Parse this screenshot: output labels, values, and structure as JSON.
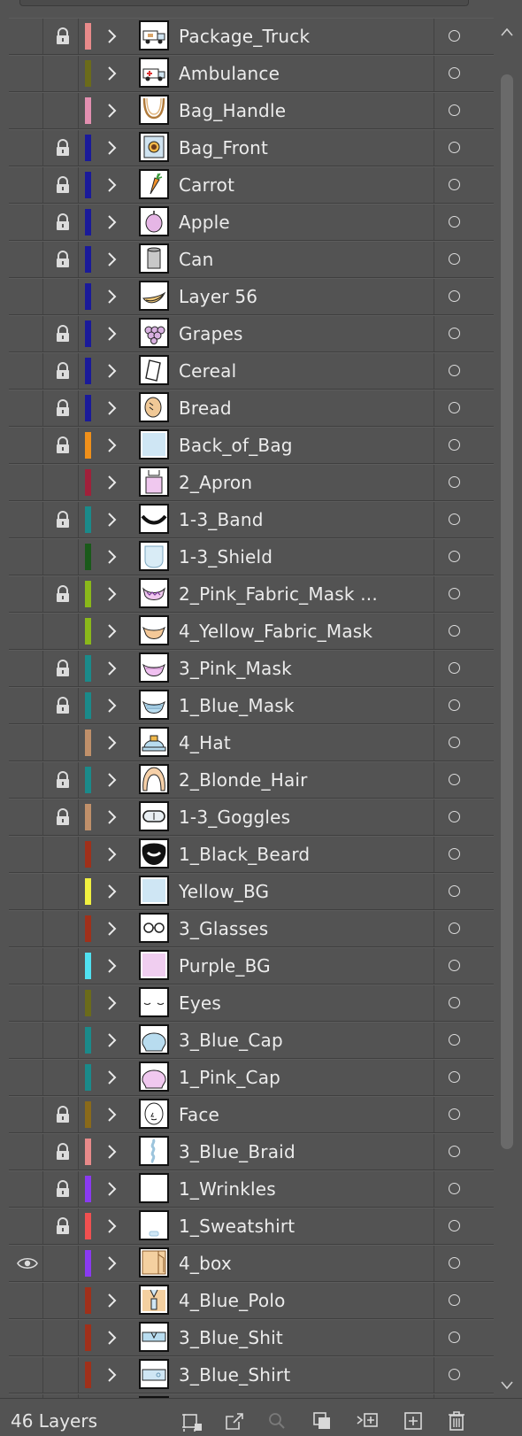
{
  "layers": [
    {
      "name": "Package_Truck",
      "locked": true,
      "visible": false,
      "color": "#e88a8a",
      "thumb": "truck"
    },
    {
      "name": "Ambulance",
      "locked": false,
      "visible": false,
      "color": "#6b6b1a",
      "thumb": "ambulance"
    },
    {
      "name": "Bag_Handle",
      "locked": false,
      "visible": false,
      "color": "#e28fb0",
      "thumb": "handle"
    },
    {
      "name": "Bag_Front",
      "locked": true,
      "visible": false,
      "color": "#1a1a9a",
      "thumb": "bagfront"
    },
    {
      "name": "Carrot",
      "locked": true,
      "visible": false,
      "color": "#1a1a9a",
      "thumb": "carrot"
    },
    {
      "name": "Apple",
      "locked": true,
      "visible": false,
      "color": "#1a1a9a",
      "thumb": "apple"
    },
    {
      "name": "Can",
      "locked": true,
      "visible": false,
      "color": "#1a1a9a",
      "thumb": "can"
    },
    {
      "name": "Layer 56",
      "locked": false,
      "visible": false,
      "color": "#1a1a9a",
      "thumb": "banana"
    },
    {
      "name": "Grapes",
      "locked": true,
      "visible": false,
      "color": "#1a1a9a",
      "thumb": "grapes"
    },
    {
      "name": "Cereal",
      "locked": true,
      "visible": false,
      "color": "#1a1a9a",
      "thumb": "cereal"
    },
    {
      "name": "Bread",
      "locked": true,
      "visible": false,
      "color": "#1a1a9a",
      "thumb": "bread"
    },
    {
      "name": "Back_of_Bag",
      "locked": true,
      "visible": false,
      "color": "#f0901a",
      "thumb": "lightblue"
    },
    {
      "name": "2_Apron",
      "locked": false,
      "visible": false,
      "color": "#a0203a",
      "thumb": "apron"
    },
    {
      "name": "1-3_Band",
      "locked": true,
      "visible": false,
      "color": "#1a8a8a",
      "thumb": "band"
    },
    {
      "name": "1-3_Shield",
      "locked": false,
      "visible": false,
      "color": "#1a5a1a",
      "thumb": "shield"
    },
    {
      "name": "2_Pink_Fabric_Mask ...",
      "locked": true,
      "visible": false,
      "color": "#8ab81a",
      "thumb": "pinkmask2"
    },
    {
      "name": "4_Yellow_Fabric_Mask",
      "locked": false,
      "visible": false,
      "color": "#8ab81a",
      "thumb": "yellowmask"
    },
    {
      "name": "3_Pink_Mask",
      "locked": true,
      "visible": false,
      "color": "#1a8a8a",
      "thumb": "pinkmask"
    },
    {
      "name": "1_Blue_Mask",
      "locked": true,
      "visible": false,
      "color": "#1a8a8a",
      "thumb": "bluemask"
    },
    {
      "name": "4_Hat",
      "locked": false,
      "visible": false,
      "color": "#c0906a",
      "thumb": "hat"
    },
    {
      "name": "2_Blonde_Hair",
      "locked": true,
      "visible": false,
      "color": "#1a8a8a",
      "thumb": "hair"
    },
    {
      "name": "1-3_Goggles",
      "locked": true,
      "visible": false,
      "color": "#c0906a",
      "thumb": "goggles"
    },
    {
      "name": "1_Black_Beard",
      "locked": false,
      "visible": false,
      "color": "#a0301a",
      "thumb": "beard"
    },
    {
      "name": "Yellow_BG",
      "locked": false,
      "visible": false,
      "color": "#f0f040",
      "thumb": "lightblue"
    },
    {
      "name": "3_Glasses",
      "locked": false,
      "visible": false,
      "color": "#a0301a",
      "thumb": "glasses"
    },
    {
      "name": "Purple_BG",
      "locked": false,
      "visible": false,
      "color": "#50e0f0",
      "thumb": "purple"
    },
    {
      "name": "Eyes",
      "locked": false,
      "visible": false,
      "color": "#6b6b1a",
      "thumb": "eyes"
    },
    {
      "name": "3_Blue_Cap",
      "locked": false,
      "visible": false,
      "color": "#1a8a8a",
      "thumb": "bluecap"
    },
    {
      "name": "1_Pink_Cap",
      "locked": false,
      "visible": false,
      "color": "#1a8a8a",
      "thumb": "pinkcap"
    },
    {
      "name": "Face",
      "locked": true,
      "visible": false,
      "color": "#8a6a1a",
      "thumb": "face"
    },
    {
      "name": "3_Blue_Braid",
      "locked": true,
      "visible": false,
      "color": "#e88a8a",
      "thumb": "braid"
    },
    {
      "name": "1_Wrinkles",
      "locked": true,
      "visible": false,
      "color": "#8a3af0",
      "thumb": "blank"
    },
    {
      "name": "1_Sweatshirt",
      "locked": true,
      "visible": false,
      "color": "#f05050",
      "thumb": "sweatshirt"
    },
    {
      "name": "4_box",
      "locked": false,
      "visible": true,
      "color": "#8a3af0",
      "thumb": "box"
    },
    {
      "name": "4_Blue_Polo",
      "locked": false,
      "visible": false,
      "color": "#a0301a",
      "thumb": "polo"
    },
    {
      "name": "3_Blue_Shit",
      "locked": false,
      "visible": false,
      "color": "#a0301a",
      "thumb": "blueshirt"
    },
    {
      "name": "3_Blue_Shirt",
      "locked": false,
      "visible": false,
      "color": "#a0301a",
      "thumb": "blueshirt2"
    },
    {
      "name": "",
      "locked": false,
      "visible": false,
      "color": "#a0301a",
      "thumb": "blank"
    }
  ],
  "footer": {
    "layer_count": "46 Layers",
    "icons": [
      "collect-export-icon",
      "export-icon",
      "search-icon",
      "clip-mask-icon",
      "new-sublayer-icon",
      "new-layer-icon",
      "trash-icon"
    ]
  }
}
